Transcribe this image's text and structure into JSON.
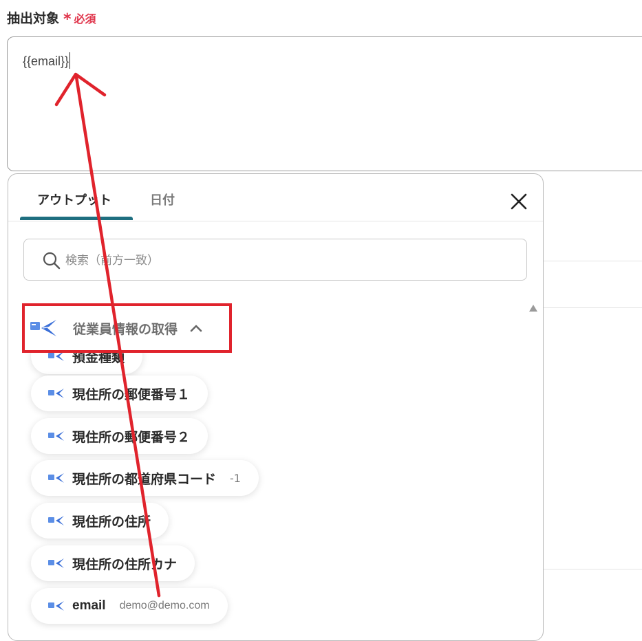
{
  "field": {
    "label": "抽出対象",
    "required_star": "*",
    "required_text": "必須",
    "value": "{{email}}"
  },
  "popup": {
    "tabs": [
      {
        "label": "アウトプット",
        "active": true
      },
      {
        "label": "日付",
        "active": false
      }
    ],
    "close_icon": "close-icon",
    "search": {
      "placeholder": "検索（前方一致）",
      "icon": "search-icon"
    },
    "group": {
      "title": "従業員情報の取得",
      "icon": "bird-app-icon",
      "expanded": true
    },
    "items": [
      {
        "label": "預金種類",
        "value": ""
      },
      {
        "label": "現住所の郵便番号１",
        "value": ""
      },
      {
        "label": "現住所の郵便番号２",
        "value": ""
      },
      {
        "label": "現住所の都道府県コード",
        "value": "-1"
      },
      {
        "label": "現住所の住所",
        "value": ""
      },
      {
        "label": "現住所の住所カナ",
        "value": ""
      },
      {
        "label": "email",
        "value": "demo@demo.com"
      }
    ]
  },
  "annotation": {
    "highlight_color": "#e0232c",
    "arrow_color": "#e0232c"
  },
  "colors": {
    "tab_indicator": "#1f6f80",
    "required": "#e0364c"
  }
}
